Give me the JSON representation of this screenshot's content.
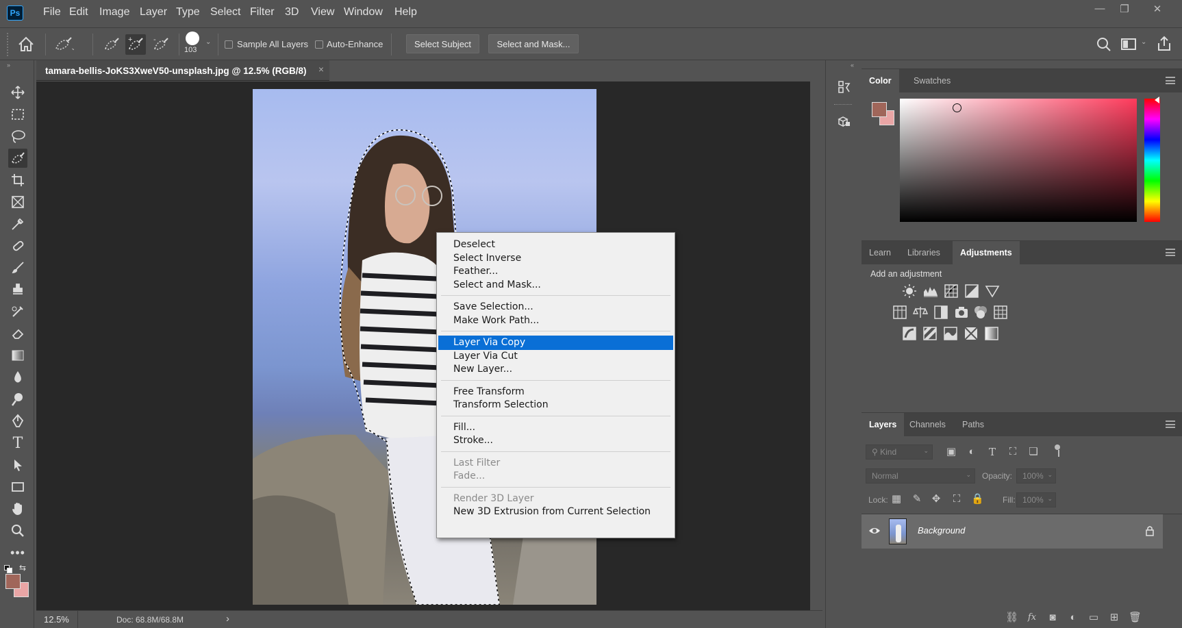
{
  "app": {
    "logo": "Ps",
    "menu": [
      "File",
      "Edit",
      "Image",
      "Layer",
      "Type",
      "Select",
      "Filter",
      "3D",
      "View",
      "Window",
      "Help"
    ],
    "window_controls": [
      "minimize-icon",
      "restore-icon",
      "close-icon"
    ]
  },
  "options": {
    "brush_size": "103",
    "sample_all_layers": "Sample All Layers",
    "auto_enhance": "Auto-Enhance",
    "select_subject": "Select Subject",
    "select_and_mask": "Select and Mask..."
  },
  "document": {
    "tab_title": "tamara-bellis-JoKS3XweV50-unsplash.jpg @ 12.5% (RGB/8)",
    "tab_close": "×",
    "zoom": "12.5%",
    "doc_info": "Doc: 68.8M/68.8M",
    "status_arrow": "›"
  },
  "context_menu": {
    "groups": [
      [
        {
          "label": "Deselect",
          "state": "normal"
        },
        {
          "label": "Select Inverse",
          "state": "normal"
        },
        {
          "label": "Feather...",
          "state": "normal"
        },
        {
          "label": "Select and Mask...",
          "state": "normal"
        }
      ],
      [
        {
          "label": "Save Selection...",
          "state": "normal"
        },
        {
          "label": "Make Work Path...",
          "state": "normal"
        }
      ],
      [
        {
          "label": "Layer Via Copy",
          "state": "highlighted"
        },
        {
          "label": "Layer Via Cut",
          "state": "normal"
        },
        {
          "label": "New Layer...",
          "state": "normal"
        }
      ],
      [
        {
          "label": "Free Transform",
          "state": "normal"
        },
        {
          "label": "Transform Selection",
          "state": "normal"
        }
      ],
      [
        {
          "label": "Fill...",
          "state": "normal"
        },
        {
          "label": "Stroke...",
          "state": "normal"
        }
      ],
      [
        {
          "label": "Last Filter",
          "state": "disabled"
        },
        {
          "label": "Fade...",
          "state": "disabled"
        }
      ],
      [
        {
          "label": "Render 3D Layer",
          "state": "disabled"
        },
        {
          "label": "New 3D Extrusion from Current Selection",
          "state": "normal"
        }
      ]
    ]
  },
  "color_panel": {
    "tabs": [
      "Color",
      "Swatches"
    ],
    "active": "Color",
    "foreground": "#a0665a",
    "background": "#e9a5a5",
    "hue": "#ff3b5c"
  },
  "adjustments_panel": {
    "tabs": [
      "Learn",
      "Libraries",
      "Adjustments"
    ],
    "active": "Adjustments",
    "hint": "Add an adjustment"
  },
  "layers_panel": {
    "tabs": [
      "Layers",
      "Channels",
      "Paths"
    ],
    "active": "Layers",
    "filter_placeholder": "Kind",
    "blend_mode": "Normal",
    "opacity_label": "Opacity:",
    "opacity_value": "100%",
    "lock_label": "Lock:",
    "fill_label": "Fill:",
    "fill_value": "100%",
    "layers": [
      {
        "name": "Background",
        "visible": true,
        "locked": true
      }
    ]
  },
  "colors": {
    "accent": "#0a6fd6",
    "canvas": "#282828",
    "chrome": "#535353"
  }
}
